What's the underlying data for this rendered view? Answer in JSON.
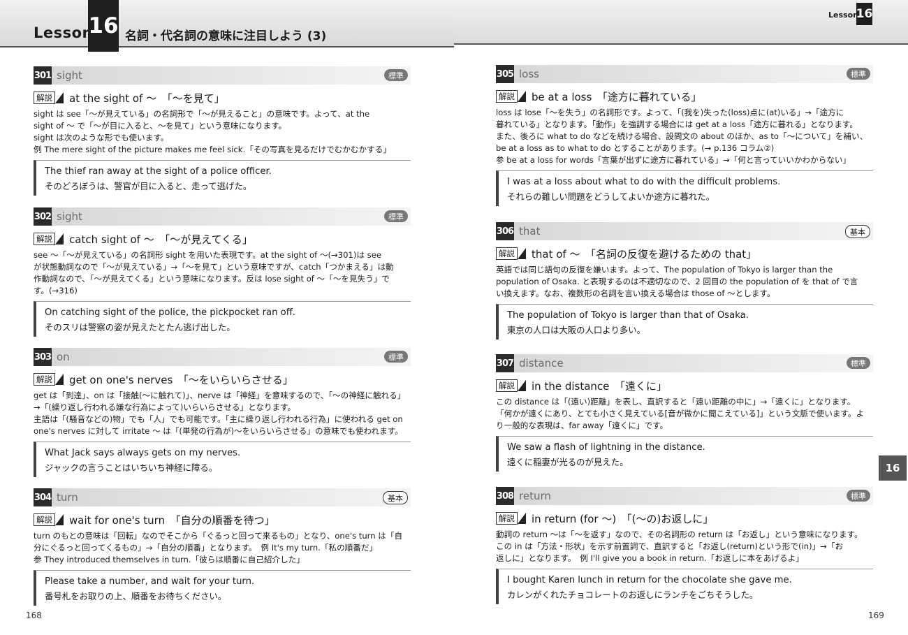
{
  "header": {
    "lesson_word": "Lesson",
    "lesson_num": "16",
    "lesson_title": "名詞・代名詞の意味に注目しよう (3)",
    "running_word": "Lesson",
    "running_num": "16"
  },
  "thumb_index": "16",
  "page_left": "168",
  "page_right": "169",
  "entries": [
    {
      "num": "301",
      "word": "sight",
      "badge": "標準",
      "tag": "解説",
      "phrase": "at the sight of ～　「～を見て」",
      "body": [
        "sight は see「～が見えている」の名詞形で「～が見えること」の意味です。よって、at the",
        "sight of ～ で「～が目に入ると、～を見て」という意味になります。",
        "sight は次のような形でも使います。",
        "例 The mere sight of the picture makes me feel sick.「その写真を見るだけでむかむかする」"
      ],
      "ex_en": "The thief ran away at the sight of a police officer.",
      "ex_ja": "そのどろぼうは、警官が目に入ると、走って逃げた。"
    },
    {
      "num": "302",
      "word": "sight",
      "badge": "標準",
      "tag": "解説",
      "phrase": "catch sight of ～　「～が見えてくる」",
      "body": [
        "see ～「～が見えている」の名詞形 sight を用いた表現です。at the sight of ～(→301)は see",
        "が状態動詞なので「～が見えている」→「～を見て」という意味ですが、catch「つかまえる」は動",
        "作動詞なので、「～が見えてくる」という意味になります。反は lose sight of ～「～を見失う」で",
        "す。(→316)"
      ],
      "ex_en": "On catching sight of the police, the pickpocket ran off.",
      "ex_ja": "そのスリは警察の姿が見えたとたん逃げ出した。"
    },
    {
      "num": "303",
      "word": "on",
      "badge": "標準",
      "tag": "解説",
      "phrase": "get on one's nerves　「～をいらいらさせる」",
      "body": [
        "get は「到達」、on は「接触(～に触れて)」、nerve は「神経」を意味するので、「～の神経に触れる」",
        "→「(繰り返し行われる嫌な行為によって)いらいらさせる」となります。",
        "主語は「(騒音などの)物」でも「人」でも可能です。「主に繰り返し行われる行為」に使われる get on",
        "one's nerves に対して irritate ～ は「(単発の行為が)～をいらいらさせる」の意味でも使われます。"
      ],
      "ex_en": "What Jack says always gets on my nerves.",
      "ex_ja": "ジャックの言うことはいちいち神経に障る。"
    },
    {
      "num": "304",
      "word": "turn",
      "badge": "基本",
      "tag": "解説",
      "phrase": "wait for one's turn　「自分の順番を待つ」",
      "body": [
        "turn のもとの意味は「回転」なのでそこから「ぐるっと回って来るもの」となり、one's turn は「自",
        "分にぐるっと回ってくるもの」→「自分の順番」となります。　例 It's my turn.「私の順番だ」",
        "参 They introduced themselves in turn.「彼らは順番に自己紹介した」"
      ],
      "ex_en": "Please take a number, and wait for your turn.",
      "ex_ja": "番号札をお取りの上、順番をお待ちください。"
    },
    {
      "num": "305",
      "word": "loss",
      "badge": "標準",
      "tag": "解説",
      "phrase": "be at a loss　「途方に暮れている」",
      "body": [
        "loss は lose「～を失う」の名詞形です。よって、「(我を)失った(loss)点に(at)いる」→「途方に",
        "暮れている」となります。「動作」を強調する場合には get at a loss「途方に暮れる」となります。",
        "また、後ろに what to do などを続ける場合、設問文の about のほか、as to「～について」を補い、",
        "be at a loss as to what to do とすることがあります。(→ p.136 コラム②)",
        "参 be at a loss for words「言葉が出ずに途方に暮れている」→「何と言っていいかわからない」"
      ],
      "ex_en": "I was at a loss about what to do with the difficult problems.",
      "ex_ja": "それらの難しい問題をどうしてよいか途方に暮れた。"
    },
    {
      "num": "306",
      "word": "that",
      "badge": "基本",
      "tag": "解説",
      "phrase": "that of ～　「名詞の反復を避けるための that」",
      "body": [
        "英語では同じ語句の反復を嫌います。よって、The population of Tokyo is larger than the",
        "population of Osaka. と表現するのは不適切なので、2 回目の the population of を that of で言",
        "い換えます。なお、複数形の名詞を言い換える場合は those of ～とします。"
      ],
      "ex_en": "The population of Tokyo is larger than that of Osaka.",
      "ex_ja": "東京の人口は大阪の人口より多い。"
    },
    {
      "num": "307",
      "word": "distance",
      "badge": "標準",
      "tag": "解説",
      "phrase": "in the distance　「遠くに」",
      "body": [
        "この distance は「(遠い)距離」を表し、直訳すると「遠い距離の中に」→「遠くに」となります。",
        "「何かが遠くにあり、とても小さく見えている[音が微かに聞こえている]」という文脈で使います。よ",
        "り一般的な表現は、far away「遠くに」です。"
      ],
      "ex_en": "We saw a flash of lightning in the distance.",
      "ex_ja": "遠くに稲妻が光るのが見えた。"
    },
    {
      "num": "308",
      "word": "return",
      "badge": "標準",
      "tag": "解説",
      "phrase": "in return (for ～)　「(～の)お返しに」",
      "body": [
        "動詞の return ～は「～を返す」なので、その名詞形の return は「お返し」という意味になります。",
        "この in は「方法・形状」を示す前置詞で、直訳すると「お返し(return)という形で(in)」→「お",
        "返しに」となります。　例 I'll give you a book in return.「お返しに本をあげるよ」"
      ],
      "ex_en": "I bought Karen lunch in return for the chocolate she gave me.",
      "ex_ja": "カレンがくれたチョコレートのお返しにランチをごちそうした。"
    }
  ]
}
